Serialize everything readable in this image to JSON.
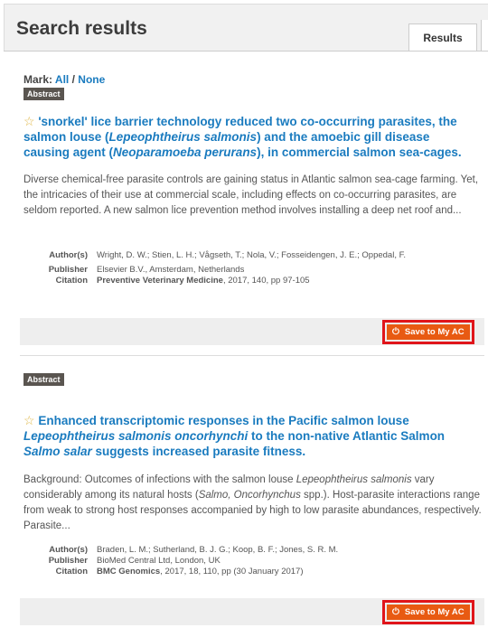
{
  "header": {
    "title": "Search results",
    "tab_label": "Results"
  },
  "mark": {
    "label": "Mark:",
    "all": "All",
    "sep": "/",
    "none": "None"
  },
  "results": [
    {
      "badge": "Abstract",
      "title_parts": [
        "'snorkel' lice barrier technology reduced two co-occurring parasites, the salmon louse (",
        "Lepeophtheirus salmonis",
        ") and the amoebic gill disease causing agent (",
        "Neoparamoeba perurans",
        "), in commercial salmon sea-cages."
      ],
      "abstract": "Diverse chemical-free parasite controls are gaining status in Atlantic salmon sea-cage farming. Yet, the intricacies of their use at commercial scale, including effects on co-occurring parasites, are seldom reported. A new salmon lice prevention method involves installing a deep net roof and...",
      "authors_label": "Author(s)",
      "authors": "Wright, D. W.; Stien, L. H.; Vågseth, T.; Nola, V.; Fosseidengen, J. E.; Oppedal, F.",
      "publisher_label": "Publisher",
      "publisher": "Elsevier B.V., Amsterdam, Netherlands",
      "citation_label": "Citation",
      "citation_journal": "Preventive Veterinary Medicine",
      "citation_rest": ", 2017, 140, pp 97-105",
      "save_label": "Save to My AC"
    },
    {
      "badge": "Abstract",
      "title_parts": [
        "Enhanced transcriptomic responses in the Pacific salmon louse ",
        "Lepeophtheirus salmonis oncorhynchi",
        " to the non-native Atlantic Salmon ",
        "Salmo salar",
        " suggests increased parasite fitness."
      ],
      "abstract_parts": [
        "Background: Outcomes of infections with the salmon louse ",
        "Lepeophtheirus salmonis",
        " vary considerably among its natural hosts (",
        "Salmo, Oncorhynchus",
        " spp.). Host-parasite interactions range from weak to strong host responses accompanied by high to low parasite abundances, respectively. Parasite..."
      ],
      "authors_label": "Author(s)",
      "authors": "Braden, L. M.; Sutherland, B. J. G.; Koop, B. F.; Jones, S. R. M.",
      "publisher_label": "Publisher",
      "publisher": "BioMed Central Ltd, London, UK",
      "citation_label": "Citation",
      "citation_journal": "BMC Genomics",
      "citation_rest": ", 2017, 18, 110, pp (30 January 2017)",
      "save_label": "Save to My AC"
    }
  ],
  "icons": {
    "star": "star-icon",
    "save": "power-save-icon"
  },
  "colors": {
    "link": "#1a7bbf",
    "save_button": "#e85a12",
    "highlight_box": "#e0151b",
    "badge": "#5a5550"
  }
}
